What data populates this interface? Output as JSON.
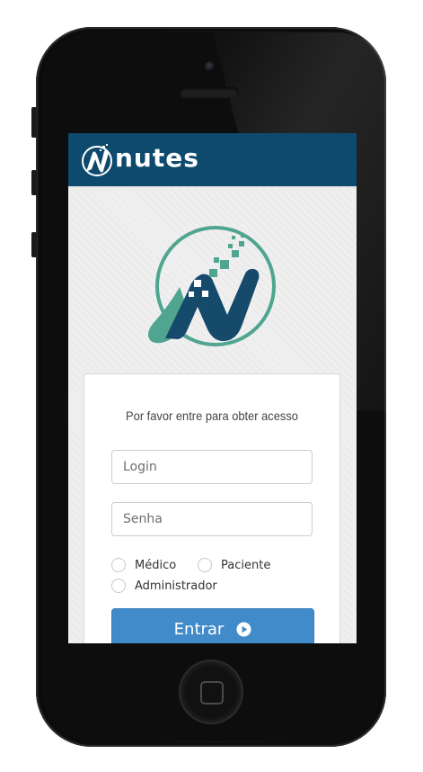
{
  "app": {
    "brand": "nutes"
  },
  "login": {
    "prompt": "Por favor entre para obter acesso",
    "login_placeholder": "Login",
    "password_placeholder": "Senha",
    "roles": [
      "Médico",
      "Paciente",
      "Administrador"
    ],
    "submit_label": "Entrar"
  },
  "colors": {
    "navbar": "#0e4a6e",
    "logo_dark": "#154a6b",
    "logo_teal": "#4fa58f",
    "button": "#428bca"
  },
  "icons": {
    "submit": "play-circle-icon",
    "logo": "nutes-n-logo"
  }
}
